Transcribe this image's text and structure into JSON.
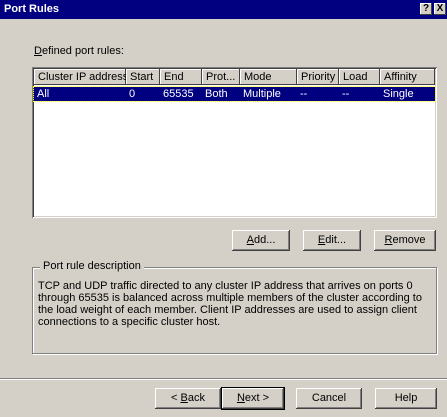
{
  "window": {
    "title": "Port Rules",
    "help_glyph": "?",
    "close_glyph": "X"
  },
  "defined_label": {
    "underlined": "D",
    "rest": "efined port rules:"
  },
  "columns": [
    "Cluster IP address",
    "Start",
    "End",
    "Prot...",
    "Mode",
    "Priority",
    "Load",
    "Affinity"
  ],
  "rows": [
    {
      "cluster_ip": "All",
      "start": "0",
      "end": "65535",
      "protocol": "Both",
      "mode": "Multiple",
      "priority": "--",
      "load": "--",
      "affinity": "Single"
    }
  ],
  "actions": {
    "add": {
      "underlined": "A",
      "rest": "dd..."
    },
    "edit": {
      "underlined": "E",
      "rest": "dit..."
    },
    "remove": {
      "underlined": "R",
      "rest": "emove"
    }
  },
  "description": {
    "title": "Port rule description",
    "text": "TCP and UDP traffic directed to any cluster IP address that arrives on ports 0 through 65535 is balanced across multiple members of the cluster according to the load weight of each member.  Client IP addresses are used to assign client connections to a specific cluster host."
  },
  "wizard": {
    "back": {
      "prefix": "< ",
      "underlined": "B",
      "rest": "ack"
    },
    "next": {
      "underlined": "N",
      "rest": "ext >"
    },
    "cancel": "Cancel",
    "help": "Help"
  },
  "colors": {
    "titlebar": "#000080",
    "face": "#d4d0c8",
    "selection": "#000080"
  }
}
